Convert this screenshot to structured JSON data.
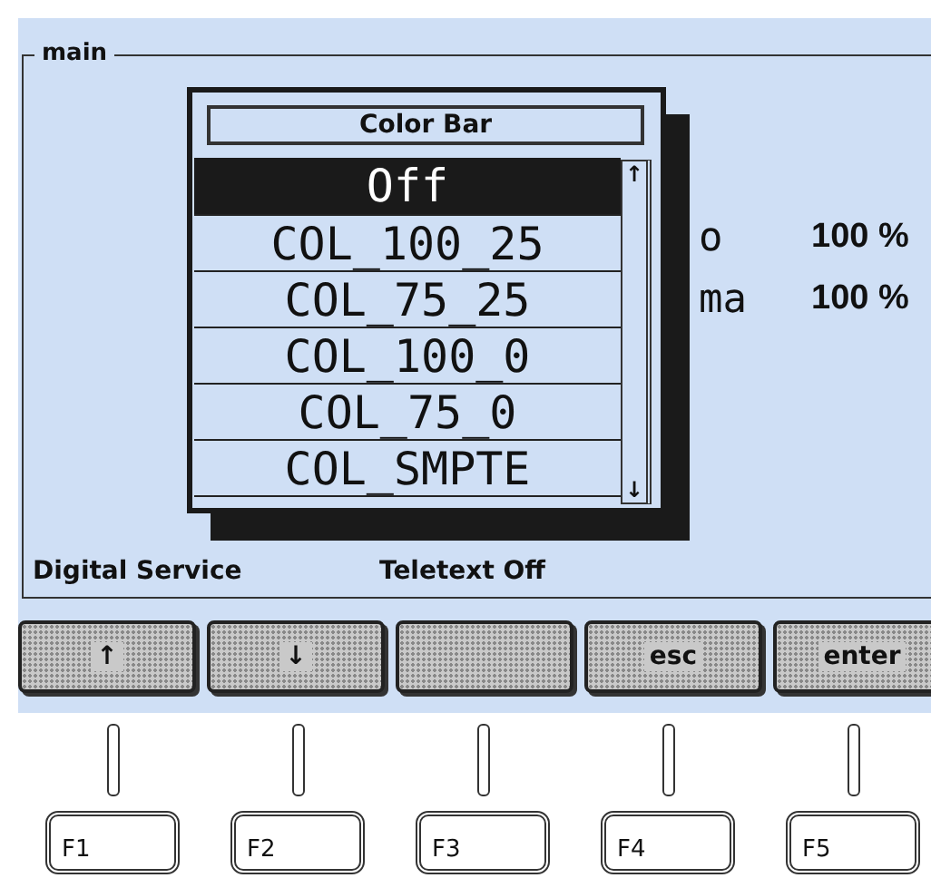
{
  "frame": {
    "title": "main"
  },
  "settings": [
    {
      "label": "o",
      "value": "100 %"
    },
    {
      "label": "ma",
      "value": "100 %"
    }
  ],
  "status": [
    "Digital Service",
    "Teletext Off"
  ],
  "popup": {
    "title": "Color Bar",
    "scroll_up": "↑",
    "scroll_down": "↓",
    "items": [
      {
        "label": "Off",
        "selected": true
      },
      {
        "label": "COL_100_25",
        "selected": false
      },
      {
        "label": "COL_75_25",
        "selected": false
      },
      {
        "label": "COL_100_0",
        "selected": false
      },
      {
        "label": "COL_75_0",
        "selected": false
      },
      {
        "label": "COL_SMPTE",
        "selected": false
      }
    ]
  },
  "softkeys": [
    {
      "kind": "text",
      "label": "↑"
    },
    {
      "kind": "text",
      "label": "↓"
    },
    {
      "kind": "blank"
    },
    {
      "kind": "text",
      "label": "esc"
    },
    {
      "kind": "text",
      "label": "enter"
    }
  ],
  "fkeys": [
    "F1",
    "F2",
    "F3",
    "F4",
    "F5"
  ]
}
